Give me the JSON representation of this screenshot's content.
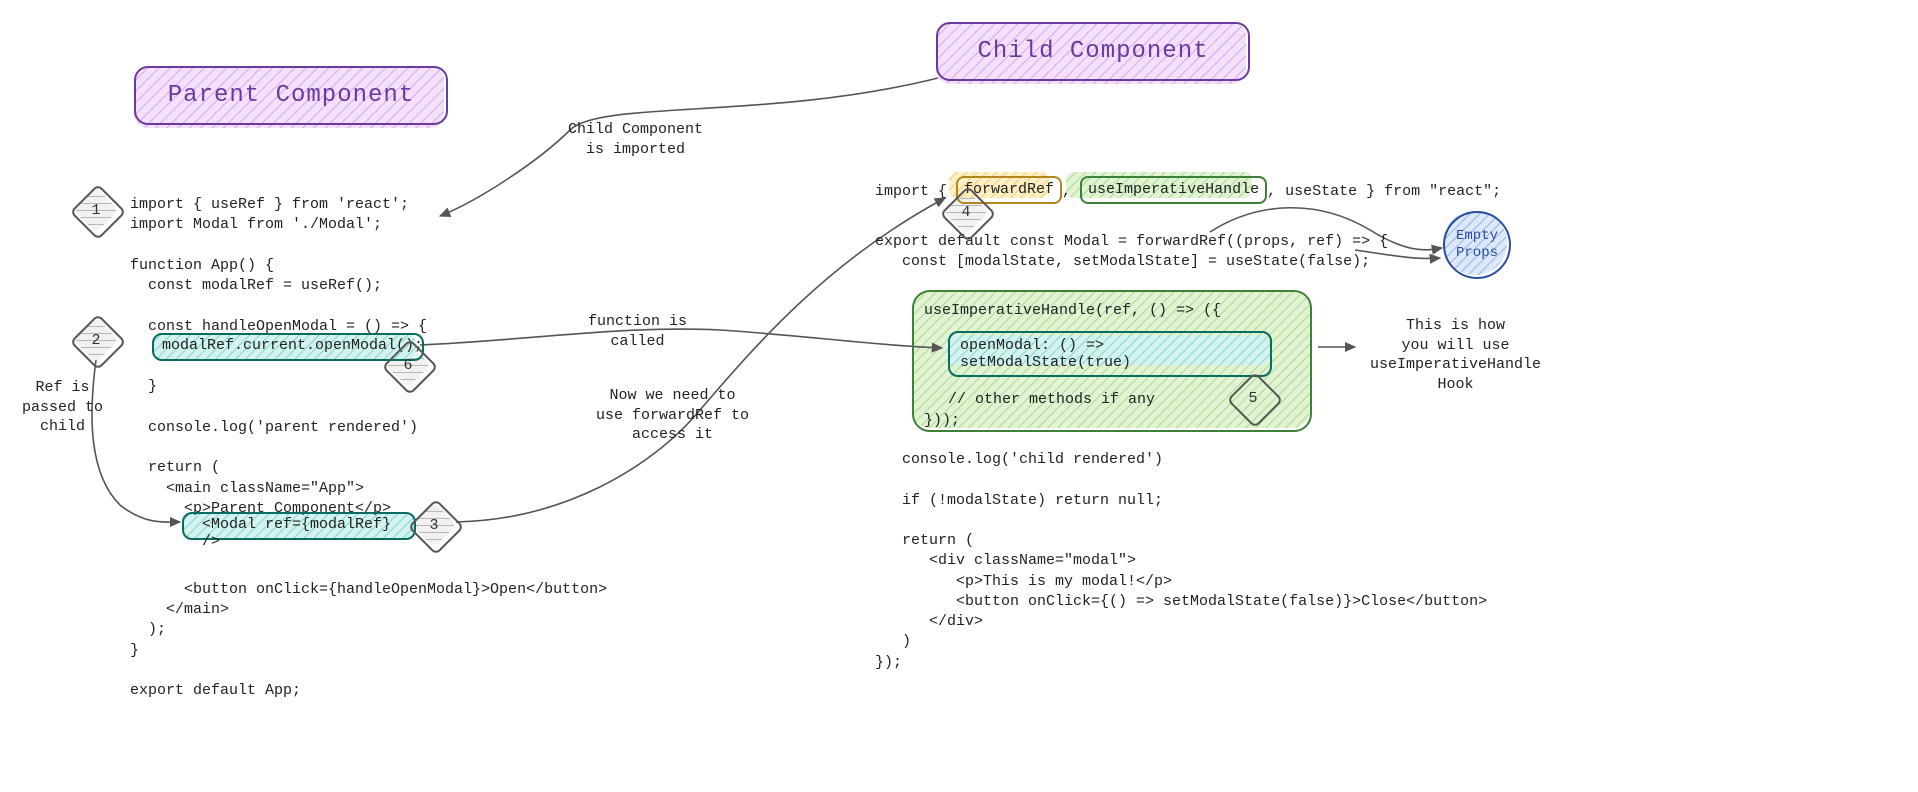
{
  "titles": {
    "parent": "Parent Component",
    "child": "Child Component"
  },
  "parent_code": "import { useRef } from 'react';\nimport Modal from './Modal';\n\nfunction App() {\n  const modalRef = useRef();\n\n  const handleOpenModal = () => {\n\n\n  }\n\n  console.log('parent rendered')\n\n  return (\n    <main className=\"App\">\n      <p>Parent Component</p>\n\n\n\n      <button onClick={handleOpenModal}>Open</button>\n    </main>\n  );\n}\n\nexport default App;",
  "parent_highlight_line": "modalRef.current.openModal();",
  "parent_modal_line": "<Modal ref={modalRef} />",
  "child_import_prefix": "import { ",
  "child_import_forwardRef": "forwardRef",
  "child_import_sep1": ", ",
  "child_import_useImperative": "useImperativeHandle",
  "child_import_suffix": ", useState } from \"react\";",
  "child_code_top": "export default const Modal = forwardRef((props, ref) => {\n   const [modalState, setModalState] = useState(false);",
  "child_useImperative_open": "useImperativeHandle(ref, () => ({",
  "child_openModal_line": "openModal: () => setModalState(true)",
  "child_other_methods": "// other methods if any",
  "child_useImperative_close": "}));",
  "child_code_bottom": "   console.log('child rendered')\n\n   if (!modalState) return null;\n\n   return (\n      <div className=\"modal\">\n         <p>This is my modal!</p>\n         <button onClick={() => setModalState(false)}>Close</button>\n      </div>\n   )\n});",
  "steps": {
    "s1": "1",
    "s2": "2",
    "s3": "3",
    "s4": "4",
    "s5": "5",
    "s6": "6"
  },
  "annotations": {
    "child_imported": "Child Component\nis imported",
    "ref_passed": "Ref is\npassed to\nchild",
    "function_called": "function is\ncalled",
    "need_forwardref": "Now we need to\nuse forwardRef to\naccess it",
    "empty_props": "Empty\nProps",
    "use_hook": "This is how\nyou will use\nuseImperativeHandle\nHook"
  }
}
